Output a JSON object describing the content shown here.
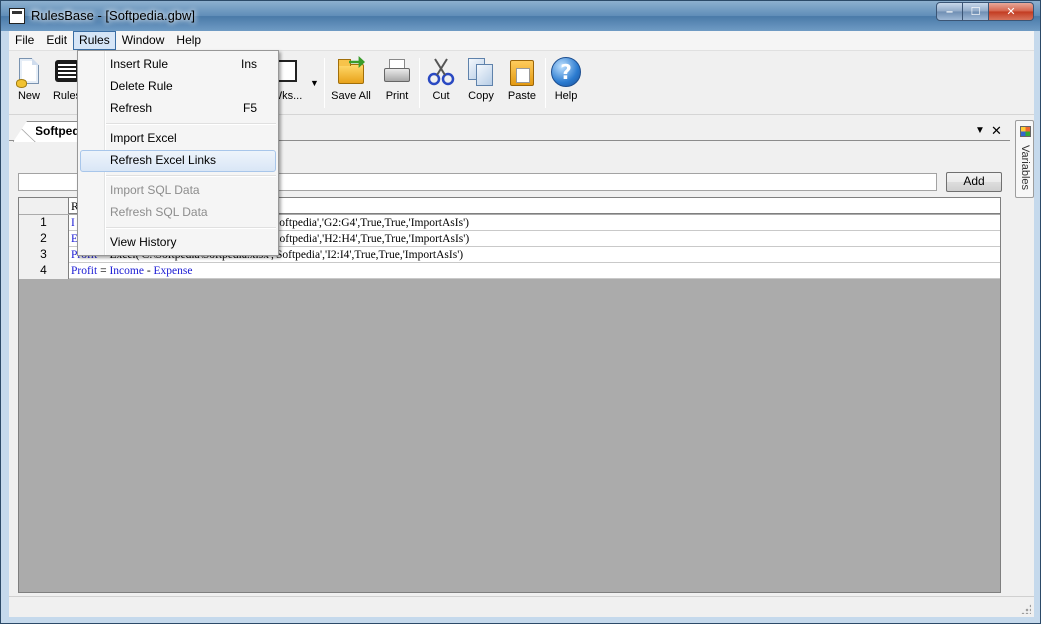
{
  "window": {
    "title": "RulesBase - [Softpedia.gbw]"
  },
  "menubar": {
    "items": [
      "File",
      "Edit",
      "Rules",
      "Window",
      "Help"
    ],
    "open": "Rules"
  },
  "toolbar": {
    "new": "New",
    "rules": "Rules",
    "wks": "Wks...",
    "save_all": "Save All",
    "print": "Print",
    "cut": "Cut",
    "copy": "Copy",
    "paste": "Paste",
    "help": "Help"
  },
  "rules_menu": {
    "items": [
      {
        "label": "Insert Rule",
        "shortcut": "Ins",
        "enabled": true
      },
      {
        "label": "Delete Rule",
        "shortcut": "",
        "enabled": true
      },
      {
        "label": "Refresh",
        "shortcut": "F5",
        "enabled": true
      },
      {
        "label": "Import Excel",
        "shortcut": "",
        "enabled": true
      },
      {
        "label": "Refresh Excel Links",
        "shortcut": "",
        "enabled": true,
        "hover": true
      },
      {
        "label": "Import SQL Data",
        "shortcut": "",
        "enabled": false
      },
      {
        "label": "Refresh SQL Data",
        "shortcut": "",
        "enabled": false
      },
      {
        "label": "View History",
        "shortcut": "",
        "enabled": true
      }
    ]
  },
  "document": {
    "tab_label": "Softpedia",
    "tab_menu_icon": "dropdown-arrow-icon",
    "tab_close_icon": "close-icon",
    "input_value": "",
    "add_button": "Add",
    "column_header": "R",
    "rows": [
      {
        "num": "1",
        "prefix": "I",
        "text": "'Softpedia','G2:G4',True,True,'ImportAsIs')"
      },
      {
        "num": "2",
        "prefix": "E",
        "text": "'Softpedia','H2:H4',True,True,'ImportAsIs')"
      },
      {
        "num": "3",
        "prefix": "Profit",
        "text": " = Excel('C:\\Softpedia\\Softpedia.xlsx','Softpedia','I2:I4',True,True,'ImportAsIs')"
      },
      {
        "num": "4",
        "prefix": "Profit",
        "text_eq": " = ",
        "term1": "Income",
        "text_minus": " - ",
        "term2": "Expense"
      }
    ]
  },
  "side_panel": {
    "label": "Variables"
  },
  "colors": {
    "keyword": "#1a1ad4",
    "grid_bg": "#ababab",
    "menu_hover": "#d9e6f6"
  }
}
